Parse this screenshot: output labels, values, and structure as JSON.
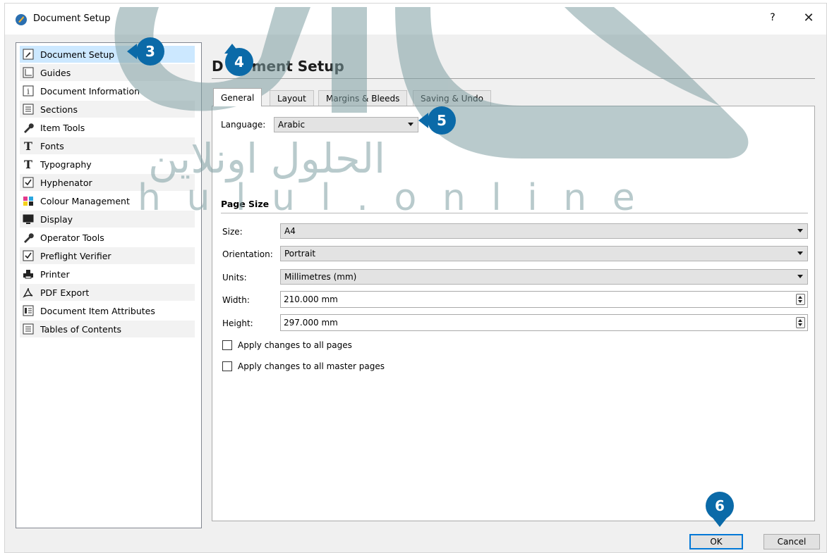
{
  "window": {
    "title": "Document Setup",
    "help_label": "?",
    "close_label": "✕"
  },
  "sidebar": {
    "items": [
      {
        "label": "Document Setup",
        "icon": "pen-nib-icon"
      },
      {
        "label": "Guides",
        "icon": "guides-icon"
      },
      {
        "label": "Document Information",
        "icon": "info-icon"
      },
      {
        "label": "Sections",
        "icon": "sections-icon"
      },
      {
        "label": "Item Tools",
        "icon": "wrench-icon"
      },
      {
        "label": "Fonts",
        "icon": "font-t-icon"
      },
      {
        "label": "Typography",
        "icon": "font-t-icon"
      },
      {
        "label": "Hyphenator",
        "icon": "checkbox-icon"
      },
      {
        "label": "Colour Management",
        "icon": "color-squares-icon"
      },
      {
        "label": "Display",
        "icon": "monitor-icon"
      },
      {
        "label": "Operator Tools",
        "icon": "wrench-icon"
      },
      {
        "label": "Preflight Verifier",
        "icon": "checkbox-icon"
      },
      {
        "label": "Printer",
        "icon": "printer-icon"
      },
      {
        "label": "PDF Export",
        "icon": "pdf-icon"
      },
      {
        "label": "Document Item Attributes",
        "icon": "attributes-icon"
      },
      {
        "label": "Tables of Contents",
        "icon": "toc-icon"
      }
    ],
    "selected": "Document Setup"
  },
  "main": {
    "title_start": "D",
    "title_end": "ment Setup",
    "tabs": [
      {
        "label": "General"
      },
      {
        "label": "Layout"
      },
      {
        "label": "Margins & Bleeds"
      },
      {
        "label": "Saving & Undo"
      }
    ],
    "active_tab": "General",
    "language": {
      "label": "Language:",
      "value": "Arabic"
    },
    "page_size": {
      "heading": "Page Size",
      "size": {
        "label": "Size:",
        "value": "A4"
      },
      "orientation": {
        "label": "Orientation:",
        "value": "Portrait"
      },
      "units": {
        "label": "Units:",
        "value": "Millimetres (mm)"
      },
      "width": {
        "label": "Width:",
        "value": "210.000 mm"
      },
      "height": {
        "label": "Height:",
        "value": "297.000 mm"
      }
    },
    "apply_all_pages": {
      "label": "Apply changes to all pages",
      "checked": false
    },
    "apply_master_pages": {
      "label": "Apply changes to all master pages",
      "checked": false
    }
  },
  "buttons": {
    "ok": "OK",
    "cancel": "Cancel"
  },
  "markers": {
    "m3": "3",
    "m4": "4",
    "m5": "5",
    "m6": "6"
  },
  "watermark": {
    "arabic": "الحلول اونلاين",
    "latin": "h u l u l . o n l i n e"
  },
  "colors": {
    "marker": "#0b6aa8",
    "selection": "#cce8ff",
    "watermark": "#7f9fa3"
  }
}
